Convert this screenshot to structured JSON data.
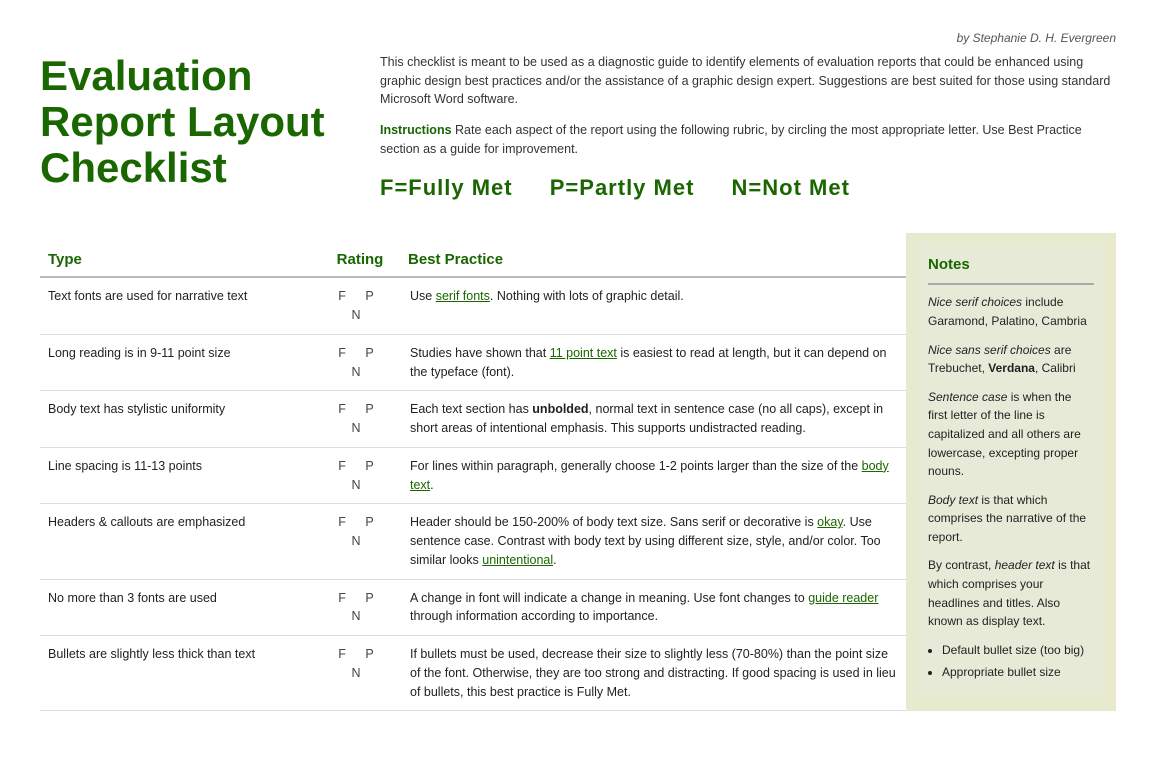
{
  "byline": "by Stephanie D. H. Evergreen",
  "title": {
    "line1": "Evaluation",
    "line2": "Report Layout",
    "line3": "Checklist"
  },
  "intro": {
    "body": "This checklist is meant to be used as a diagnostic guide to identify elements of evaluation reports that could be enhanced using graphic design best practices and/or the assistance of a graphic design expert. Suggestions are best suited for those using standard Microsoft Word software.",
    "instructions_label": "Instructions",
    "instructions_text": " Rate each aspect of the report using the following rubric, by circling the most appropriate letter. Use Best Practice section as a guide for improvement."
  },
  "rubric": {
    "f": "F=Fully Met",
    "p": "P=Partly Met",
    "n": "N=Not Met"
  },
  "headers": {
    "type": "Type",
    "rating": "Rating",
    "best_practice": "Best Practice",
    "notes": "Notes"
  },
  "rows": [
    {
      "type": "Text fonts are used for narrative text",
      "rating": "F   P   N",
      "best_practice": "Use serif fonts. Nothing with lots of graphic detail."
    },
    {
      "type": "Long reading is in 9-11 point size",
      "rating": "F   P   N",
      "best_practice": "Studies have shown that 11 point text is easiest to read at length, but it can depend on the typeface (font)."
    },
    {
      "type": "Body text has stylistic uniformity",
      "rating": "F   P   N",
      "best_practice": "Each text section has unbolded, normal text in sentence case (no all caps), except in short areas of intentional emphasis. This supports undistracted reading."
    },
    {
      "type": "Line spacing is 11-13 points",
      "rating": "F   P   N",
      "best_practice": "For lines within paragraph, generally choose 1-2 points larger than the size of the body text."
    },
    {
      "type": "Headers & callouts are emphasized",
      "rating": "F   P   N",
      "best_practice": "Header should be 150-200% of body text size. Sans serif or decorative is okay. Use sentence case. Contrast with body text by using different size, style, and/or color. Too similar looks unintentional."
    },
    {
      "type": "No more than 3 fonts are used",
      "rating": "F   P   N",
      "best_practice": "A change in font will indicate a change in meaning. Use font changes to guide reader through information according to importance."
    },
    {
      "type": "Bullets are slightly less thick than text",
      "rating": "F   P   N",
      "best_practice": "If bullets must be used, decrease their size to slightly less (70-80%) than the point size of the font. Otherwise, they are too strong and distracting. If good spacing is used in lieu of bullets, this best practice is Fully Met."
    }
  ],
  "notes": {
    "header": "Notes",
    "paragraphs": [
      {
        "italic_part": "Nice serif choices",
        "rest": " include Garamond, Palatino, Cambria"
      },
      {
        "italic_part": "Nice sans serif choices",
        "rest": " are Trebuchet, Verdana, Calibri"
      },
      {
        "italic_part": "Sentence case",
        "rest": " is when the first letter of the line is capitalized and all others are lowercase, excepting proper nouns."
      },
      {
        "italic_part": "Body text",
        "rest": " is that which comprises the narrative of the report."
      },
      {
        "plain": "By contrast, ",
        "italic_part": "header text",
        "rest": " is that which comprises your headlines and titles. Also known as display text."
      }
    ],
    "bullets": [
      "Default bullet size (too big)",
      "Appropriate bullet size"
    ]
  }
}
